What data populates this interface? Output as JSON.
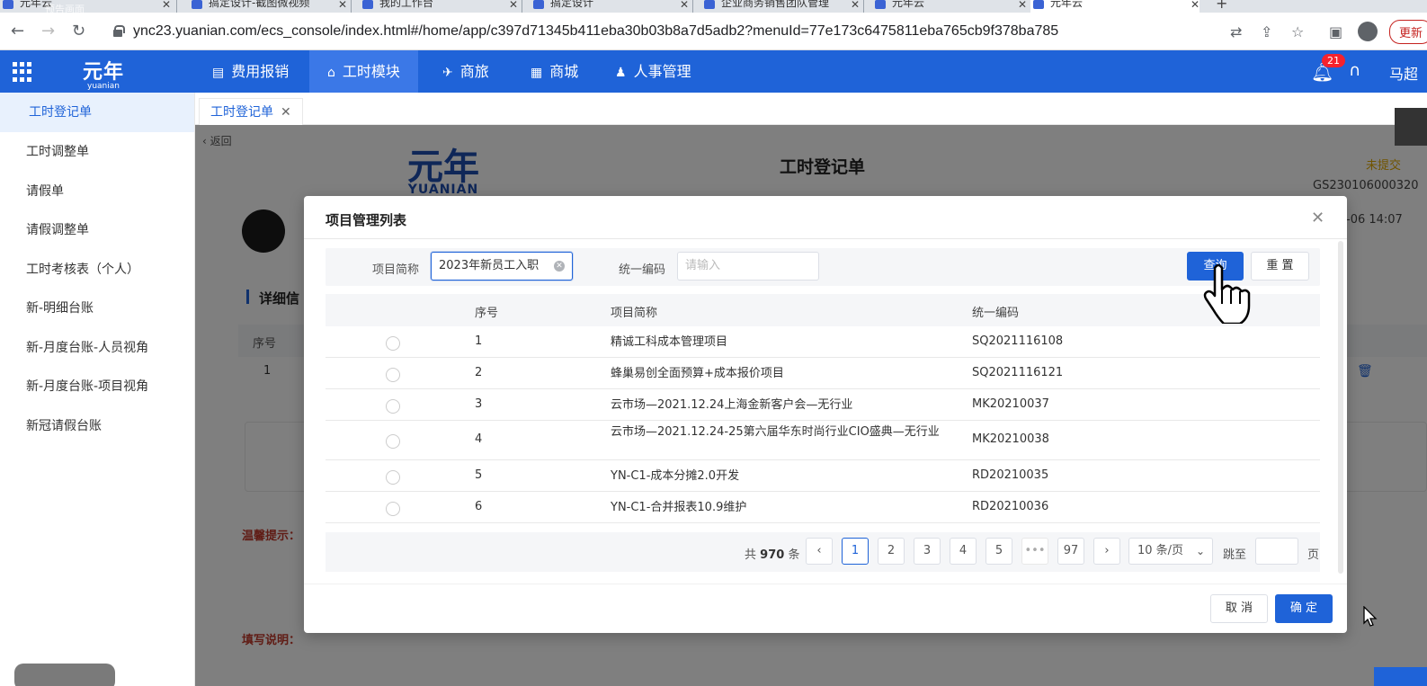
{
  "browser": {
    "tabs": [
      {
        "title": "元年云"
      },
      {
        "title": "搞定设计-截图微视频"
      },
      {
        "title": "我的工作台"
      },
      {
        "title": "搞定设计"
      },
      {
        "title": "企业商务销售团队管理"
      },
      {
        "title": "元年云"
      },
      {
        "title": "元年云"
      }
    ],
    "watermark": "预告画面",
    "url": "ync23.yuanian.com/ecs_console/index.html#/home/app/c397d71345b411eba30b03b8a7d5adb2?menuId=77e173c6475811eba765cb9f378ba785",
    "update_label": "更新"
  },
  "header": {
    "logo_cn": "元年",
    "logo_en": "yuanian",
    "modules": [
      {
        "label": "费用报销",
        "icon": "expense-icon"
      },
      {
        "label": "工时模块",
        "icon": "timesheet-icon"
      },
      {
        "label": "商旅",
        "icon": "travel-icon"
      },
      {
        "label": "商城",
        "icon": "store-icon"
      },
      {
        "label": "人事管理",
        "icon": "hr-icon"
      }
    ],
    "notif_count": "21",
    "user_name": "马超"
  },
  "sidebar": {
    "items": [
      {
        "label": "工时登记单"
      },
      {
        "label": "工时调整单"
      },
      {
        "label": "请假单"
      },
      {
        "label": "请假调整单"
      },
      {
        "label": "工时考核表（个人）"
      },
      {
        "label": "新-明细台账"
      },
      {
        "label": "新-月度台账-人员视角"
      },
      {
        "label": "新-月度台账-项目视角"
      },
      {
        "label": "新冠请假台账"
      }
    ]
  },
  "content_tab": {
    "label": "工时登记单"
  },
  "page": {
    "back": "返回",
    "logo_cn": "元年",
    "logo_en": "YUANIAN",
    "title": "工时登记单",
    "status": "未提交",
    "doc_no": "GS230106000320",
    "datetime": "-06 14:07",
    "section_title": "详细信",
    "inner_col_no": "序号",
    "inner_row_no": "1",
    "tip_label": "温馨提示：",
    "fill_label": "填写说明："
  },
  "modal": {
    "title": "项目管理列表",
    "filter": {
      "name_label": "项目简称",
      "name_value": "2023年新员工入职",
      "code_label": "统一编码",
      "code_placeholder": "请输入",
      "query_btn": "查询",
      "reset_btn": "重 置"
    },
    "columns": {
      "no": "序号",
      "name": "项目简称",
      "code": "统一编码"
    },
    "rows": [
      {
        "no": "1",
        "name": "精诚工科成本管理项目",
        "code": "SQ2021116108"
      },
      {
        "no": "2",
        "name": "蜂巢易创全面预算+成本报价项目",
        "code": "SQ2021116121"
      },
      {
        "no": "3",
        "name": "云市场—2021.12.24上海金新客户会—无行业",
        "code": "MK20210037"
      },
      {
        "no": "4",
        "name": "云市场—2021.12.24-25第六届华东时尚行业CIO盛典—无行业",
        "code": "MK20210038"
      },
      {
        "no": "5",
        "name": "YN-C1-成本分摊2.0开发",
        "code": "RD20210035"
      },
      {
        "no": "6",
        "name": "YN-C1-合并报表10.9维护",
        "code": "RD20210036"
      }
    ],
    "pagination": {
      "total_prefix": "共",
      "total": "970",
      "total_suffix": "条",
      "pages": [
        "1",
        "2",
        "3",
        "4",
        "5"
      ],
      "ellipsis": "•••",
      "last_page": "97",
      "current_page": "1",
      "page_size": "10 条/页",
      "jump_label": "跳至",
      "jump_suffix": "页"
    },
    "cancel_btn": "取 消",
    "confirm_btn": "确 定"
  },
  "colors": {
    "primary": "#1f63d8",
    "status": "#e0a800",
    "tip": "#c0392b"
  }
}
